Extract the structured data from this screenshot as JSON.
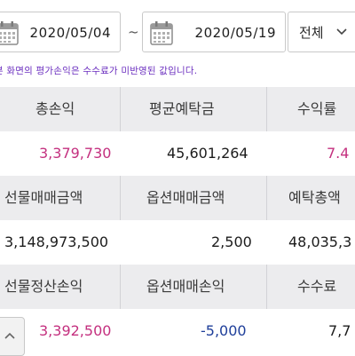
{
  "filter": {
    "start_date": "2020/05/04",
    "separator": "~",
    "end_date": "2020/05/19",
    "scope": "전체"
  },
  "notice": "본 화면의 평가손익은 수수료가 미반영된 값입니다.",
  "summary": {
    "row1_headers": [
      "총손익",
      "평균예탁금",
      "수익률"
    ],
    "row1_values": [
      "3,379,730",
      "45,601,264",
      "7.4"
    ],
    "row2_headers": [
      "선물매매금액",
      "옵션매매금액",
      "예탁총액"
    ],
    "row2_values": [
      "3,148,973,500",
      "2,500",
      "48,035,3"
    ],
    "row3_headers": [
      "선물정산손익",
      "옵션매매손익",
      "수수료"
    ],
    "row3_values": [
      "3,392,500",
      "-5,000",
      "7,7"
    ]
  },
  "colors": {
    "profit": "#c4307f",
    "loss": "#1f3f9a",
    "notice": "#6a2dbf",
    "header_bg": "#ececee"
  },
  "icons": {
    "calendar": "calendar-icon",
    "dropdown": "chevron-down-icon",
    "scroll_up": "chevron-up-icon"
  }
}
